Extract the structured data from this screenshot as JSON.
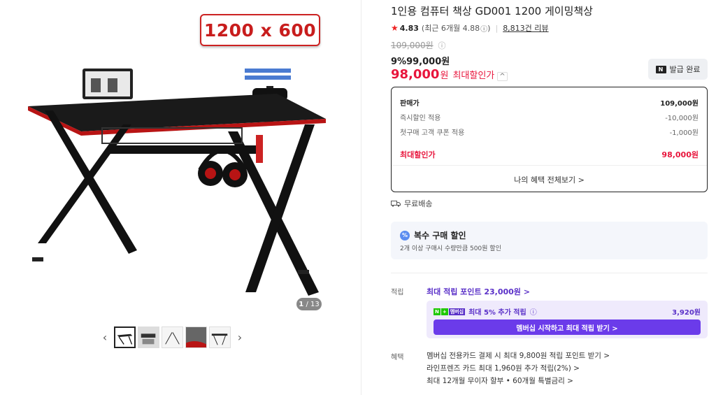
{
  "gallery": {
    "size_badge": "1200 x 600",
    "counter_current": "1",
    "counter_total": "/ 13",
    "thumb_prev": "‹",
    "thumb_next": "›"
  },
  "product": {
    "title": "1인용 컴퓨터 책상 GD001 1200 게이밍책상",
    "rating": "4.83",
    "rating_recent": "(최근 6개월 4.88",
    "rating_recent_close": ")",
    "reviews": "8,813건 리뷰"
  },
  "price": {
    "original": "109,000원",
    "discount": "9%99,000원",
    "max_value": "98,000",
    "max_won": "원",
    "max_label": "최대할인가",
    "max_chevron": "^",
    "coupon_icon": "N",
    "coupon_label": "발급 완료"
  },
  "price_box": {
    "rows": [
      {
        "label": "판매가",
        "value": "109,000원"
      },
      {
        "label": "즉시할인 적용",
        "value": "-10,000원"
      },
      {
        "label": "첫구매 고객 쿠폰 적용",
        "value": "-1,000원"
      },
      {
        "label": "최대할인가",
        "value": "98,000원"
      }
    ],
    "all_benefits": "나의 혜택 전체보기 >"
  },
  "shipping": {
    "label": "무료배송"
  },
  "multi_discount": {
    "icon": "%",
    "title": "복수 구매 할인",
    "desc": "2개 이상 구매시 수량만큼 500원 할인"
  },
  "points": {
    "label": "적립",
    "max_link": "최대 적립 포인트 23,000원 >",
    "badge_n": "N",
    "badge_plus": "+",
    "badge_member": "멤버십",
    "extra": "최대 5% 추가 적립",
    "extra_amount": "3,920원",
    "member_button": "멤버십 시작하고 최대 적립 받기 >"
  },
  "benefits": {
    "label": "혜택",
    "items": [
      "멤버십 전용카드 결제 시 최대 9,800원 적립 포인트 받기 >",
      "라인프렌즈 카드 최대 1,960원 추가 적립(2%) >",
      "최대 12개월 무이자 할부 • 60개월 특별금리 >"
    ]
  },
  "colors": {
    "accent_red": "#e8153c",
    "member_purple": "#6b3bea",
    "naver_green": "#1ec800"
  }
}
